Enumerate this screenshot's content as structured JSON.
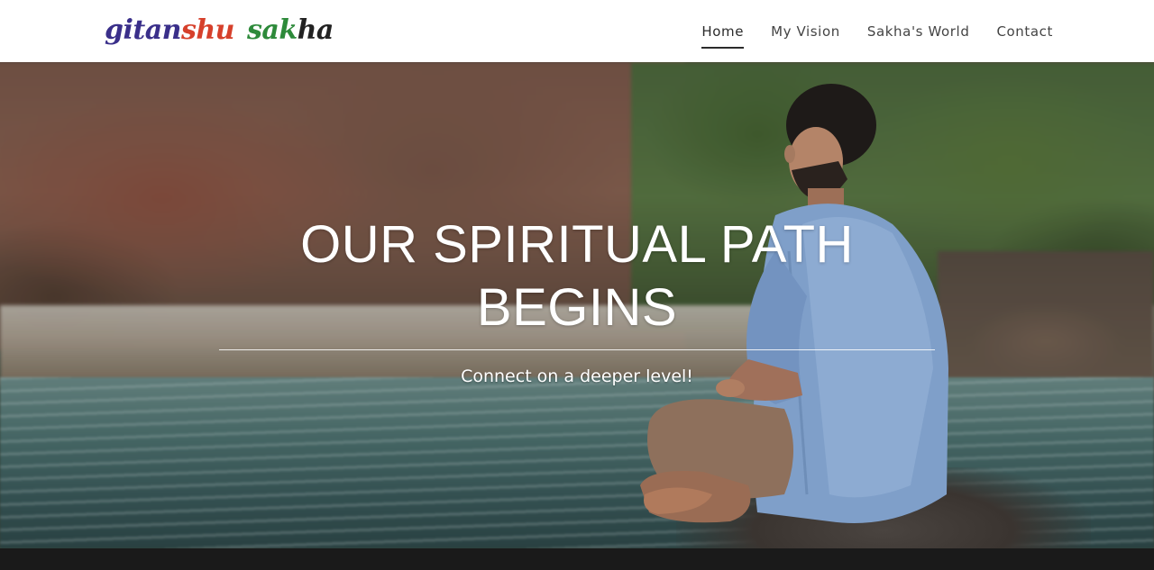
{
  "header": {
    "logo": {
      "segments": [
        {
          "text": "gitan",
          "color": "#3a2f8a"
        },
        {
          "text": "shu",
          "color": "#d6402b"
        },
        {
          "text": "sak",
          "color": "#2d8a3a"
        },
        {
          "text": "ha",
          "color": "#222222"
        }
      ]
    },
    "nav": [
      {
        "label": "Home",
        "active": true
      },
      {
        "label": "My Vision",
        "active": false
      },
      {
        "label": "Sakha's World",
        "active": false
      },
      {
        "label": "Contact",
        "active": false
      }
    ]
  },
  "hero": {
    "title_line1": "OUR SPIRITUAL PATH",
    "title_line2": "BEGINS",
    "subtitle": "Connect on a deeper level!"
  },
  "colors": {
    "nav_text": "#444444",
    "footer_band": "#1a1a1a",
    "hero_text": "#ffffff"
  }
}
